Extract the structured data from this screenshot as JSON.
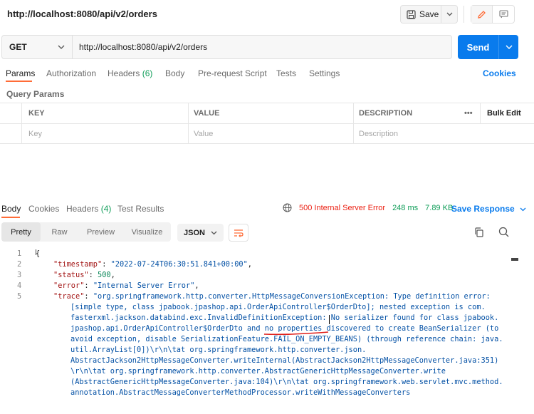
{
  "title_bar": {
    "url_title": "http://localhost:8080/api/v2/orders",
    "save_label": "Save"
  },
  "request": {
    "method": "GET",
    "url": "http://localhost:8080/api/v2/orders",
    "send_label": "Send"
  },
  "request_tabs": {
    "items": [
      {
        "label": "Params"
      },
      {
        "label": "Authorization"
      },
      {
        "label": "Headers",
        "count": "(6)"
      },
      {
        "label": "Body"
      },
      {
        "label": "Pre-request Script"
      },
      {
        "label": "Tests"
      },
      {
        "label": "Settings"
      }
    ],
    "cookies_label": "Cookies"
  },
  "query_params": {
    "label": "Query Params",
    "columns": [
      "KEY",
      "VALUE",
      "DESCRIPTION"
    ],
    "more_label": "•••",
    "bulk_edit_label": "Bulk Edit",
    "placeholders": {
      "key": "Key",
      "value": "Value",
      "description": "Description"
    }
  },
  "response_tabs": {
    "items": [
      {
        "label": "Body"
      },
      {
        "label": "Cookies"
      },
      {
        "label": "Headers",
        "count": "(4)"
      },
      {
        "label": "Test Results"
      }
    ],
    "status": "500 Internal Server Error",
    "time": "248 ms",
    "size": "7.89 KB",
    "save_response_label": "Save Response"
  },
  "response_toolbar": {
    "formats": [
      "Pretty",
      "Raw",
      "Preview",
      "Visualize"
    ],
    "selected_format": "Pretty",
    "language": "JSON"
  },
  "code": {
    "line_numbers": [
      "1",
      "2",
      "3",
      "4",
      "5"
    ],
    "open_brace": "{",
    "timestamp_key": "\"timestamp\"",
    "timestamp_value": "\"2022-07-24T06:30:51.841+00:00\"",
    "status_key": "\"status\"",
    "status_value": "500",
    "error_key": "\"error\"",
    "error_value": "\"Internal Server Error\"",
    "trace_key": "\"trace\"",
    "trace_lines": [
      "\"org.springframework.http.converter.HttpMessageConversionException: Type definition error:",
      "[simple type, class jpabook.jpashop.api.OrderApiController$OrderDto]; nested exception is com.",
      "fasterxml.jackson.databind.exc.InvalidDefinitionException: No serializer found for class jpabook.",
      "jpashop.api.OrderApiController$OrderDto and no properties discovered to create BeanSerializer (to",
      "avoid exception, disable SerializationFeature.FAIL_ON_EMPTY_BEANS) (through reference chain: java.",
      "util.ArrayList[0])\\r\\n\\tat org.springframework.http.converter.json.",
      "AbstractJackson2HttpMessageConverter.writeInternal(AbstractJackson2HttpMessageConverter.java:351)",
      "\\r\\n\\tat org.springframework.http.converter.AbstractGenericHttpMessageConverter.write",
      "(AbstractGenericHttpMessageConverter.java:104)\\r\\n\\tat org.springframework.web.servlet.mvc.method.",
      "annotation.AbstractMessageConverterMethodProcessor.writeWithMessageConverters"
    ]
  },
  "colors": {
    "accent_orange": "#ff6c37",
    "send_blue": "#097bed",
    "error_red": "#eb2013",
    "count_green": "#0f9d58"
  }
}
